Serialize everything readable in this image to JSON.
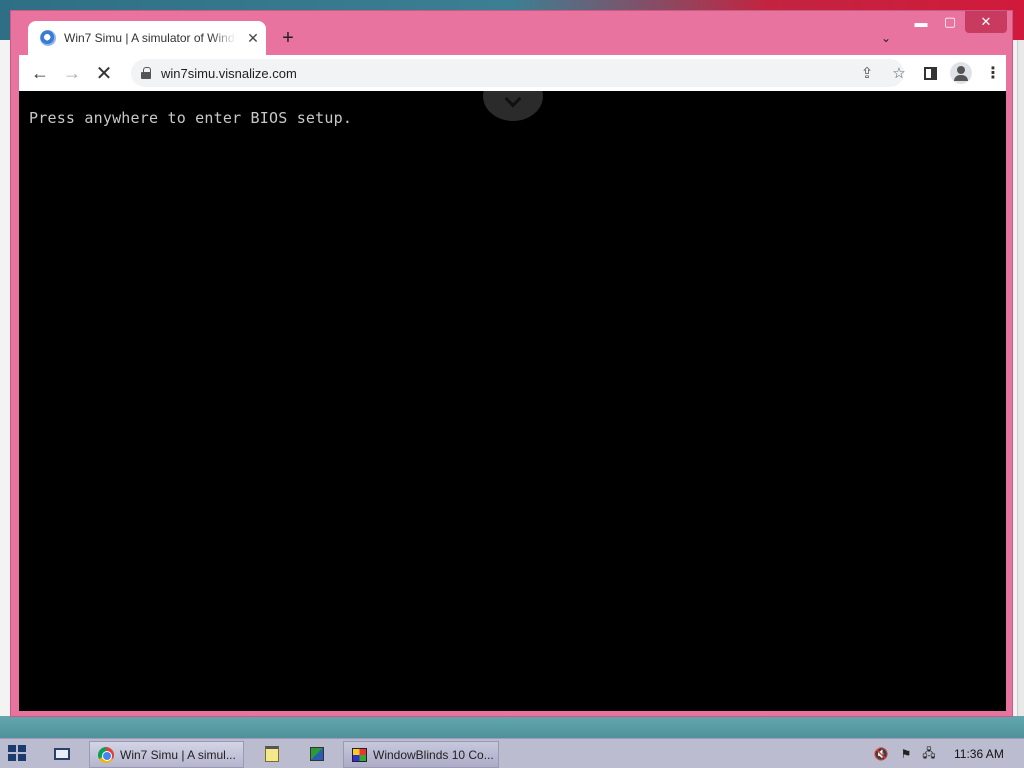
{
  "browser": {
    "tab": {
      "title": "Win7 Simu | A simulator of Windows 7",
      "close_label": "✕"
    },
    "new_tab_label": "+",
    "tab_search_label": "⌄",
    "window_controls": {
      "minimize": "▬",
      "maximize": "▢",
      "close": "✕"
    },
    "nav": {
      "back": "←",
      "forward": "→",
      "reload": "✕"
    },
    "address": {
      "url": "win7simu.visnalize.com"
    },
    "toolbar_icons": {
      "share": "⇪",
      "star": "☆",
      "menu": "⋮"
    }
  },
  "page": {
    "bios_message": "Press anywhere to enter BIOS setup.",
    "background_color": "#000000",
    "text_color": "#c8c8c8"
  },
  "taskbar": {
    "items": [
      {
        "label": "Win7 Simu | A simul...",
        "icon": "chrome-icon"
      },
      {
        "label": "WindowBlinds 10 Co...",
        "icon": "windowblinds-icon"
      }
    ],
    "clock": "11:36 AM"
  },
  "colors": {
    "window_frame": "#e8739f",
    "taskbar": "#bcbcd0"
  }
}
